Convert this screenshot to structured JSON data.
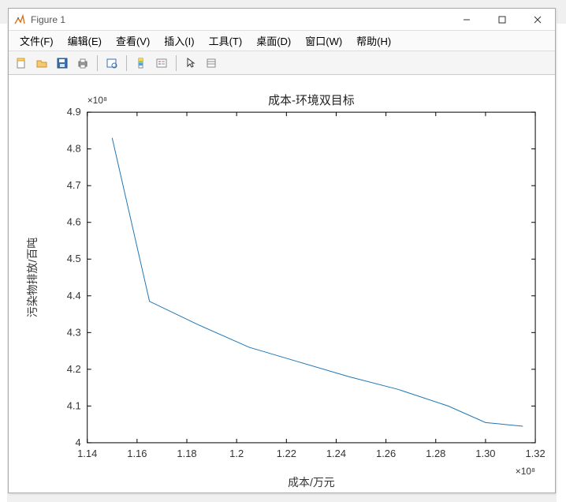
{
  "window": {
    "title": "Figure 1"
  },
  "menus": {
    "file": "文件(F)",
    "edit": "编辑(E)",
    "view": "查看(V)",
    "insert": "插入(I)",
    "tools": "工具(T)",
    "desktop": "桌面(D)",
    "window": "窗口(W)",
    "help": "帮助(H)"
  },
  "toolbar_icons": {
    "new": "new-file-icon",
    "open": "open-folder-icon",
    "save": "save-icon",
    "print": "print-icon",
    "datacursor": "data-cursor-icon",
    "colorbar": "colorbar-icon",
    "legend": "legend-icon",
    "pointer": "pointer-icon",
    "brush": "brush-icon"
  },
  "chart_data": {
    "type": "line",
    "title": "成本-环境双目标",
    "xlabel": "成本/万元",
    "ylabel": "污染物排放/百吨",
    "x_exponent_label": "×10⁸",
    "y_exponent_label": "×10⁸",
    "xlim": [
      1.14,
      1.32
    ],
    "ylim": [
      4.0,
      4.9
    ],
    "xticks": [
      1.14,
      1.16,
      1.18,
      1.2,
      1.22,
      1.24,
      1.26,
      1.28,
      1.3,
      1.32
    ],
    "yticks": [
      4.0,
      4.1,
      4.2,
      4.3,
      4.4,
      4.5,
      4.6,
      4.7,
      4.8,
      4.9
    ],
    "x": [
      1.15,
      1.165,
      1.185,
      1.205,
      1.225,
      1.245,
      1.265,
      1.285,
      1.3,
      1.315
    ],
    "y": [
      4.83,
      4.385,
      4.32,
      4.26,
      4.22,
      4.18,
      4.145,
      4.1,
      4.055,
      4.045
    ],
    "line_color": "#1f77b4"
  }
}
